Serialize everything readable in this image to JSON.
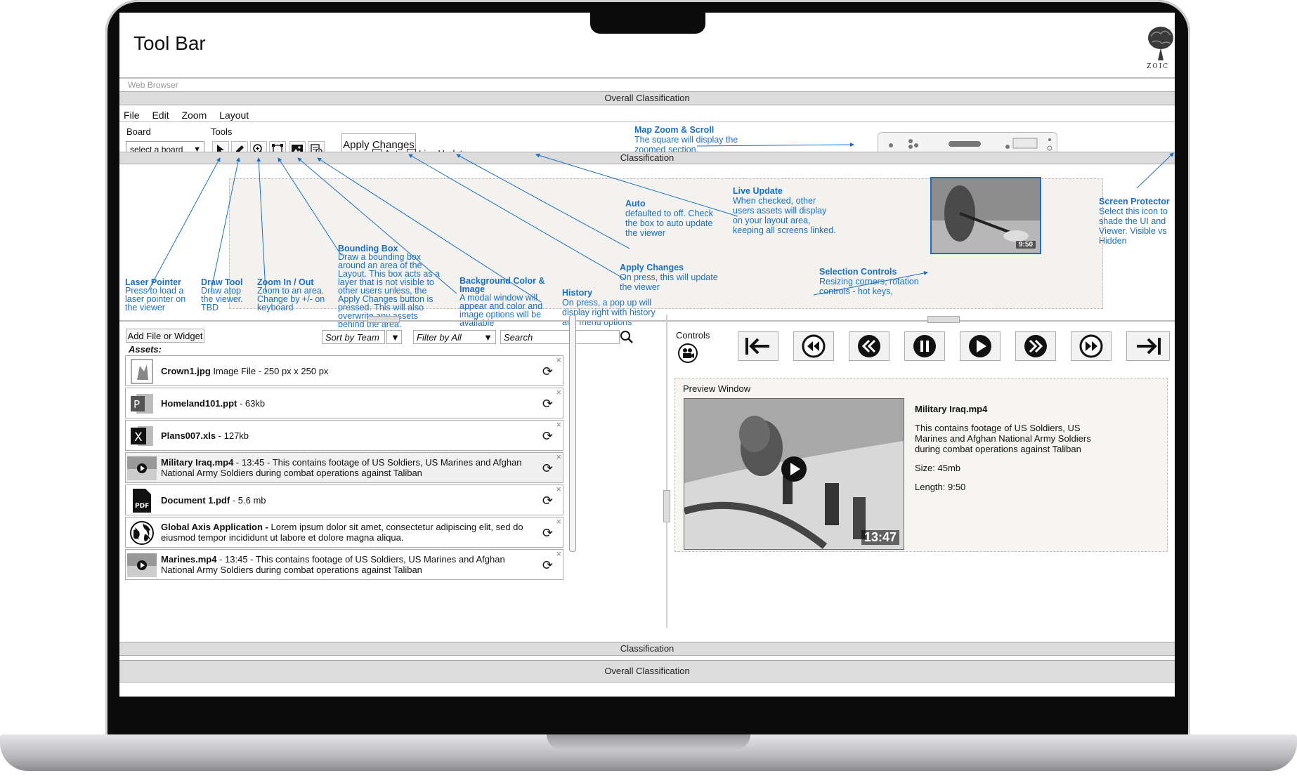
{
  "app": {
    "title": "Tool Bar",
    "logo_text": "ZOIC",
    "web_browser_label": "Web Browser"
  },
  "classification": {
    "overall_top": "Overall Classification",
    "mid_top": "Classification",
    "mid_bottom": "Classification",
    "overall_bottom": "Overall Classification"
  },
  "menu": {
    "items": [
      "File",
      "Edit",
      "Zoom",
      "Layout"
    ]
  },
  "toolbar": {
    "board_label": "Board",
    "board_value": "select a board",
    "tools_label": "Tools",
    "tools": [
      "laser-pointer",
      "draw-tool",
      "zoom",
      "bounding-box",
      "background-image",
      "history"
    ],
    "apply_label": "Apply Changes",
    "auto_label": "Auto",
    "live_update_label": "Live Update"
  },
  "annotations": {
    "map_zoom": {
      "title": "Map Zoom & Scroll",
      "body": "The square will display the zoomed section."
    },
    "live_update": {
      "title": "Live Update",
      "body": "When checked, other users assets will display on your layout area, keeping all screens linked."
    },
    "auto": {
      "title": "Auto",
      "body": "defaulted to off. Check the box to auto update the viewer"
    },
    "screen_protector": {
      "title": "Screen Protector",
      "body": "Select this icon to shade the UI and Viewer. Visible vs Hidden"
    },
    "bounding_box": {
      "title": "Bounding Box",
      "body": "Draw a bounding box around an area of the Layout. This box acts as a layer that is not visible to other users unless, the Apply Changes button is pressed. This will also overwrite any assets behind the area."
    },
    "apply_changes": {
      "title": "Apply Changes",
      "body": "On press, this will update the viewer"
    },
    "selection_controls": {
      "title": "Selection Controls",
      "body": "Resizing corners, rotation controls - hot keys,"
    },
    "laser_pointer": {
      "title": "Laser Pointer",
      "body": "Press to load a laser pointer on the viewer"
    },
    "draw_tool": {
      "title": "Draw Tool",
      "body": "Draw atop the viewer. TBD"
    },
    "zoom": {
      "title": "Zoom In / Out",
      "body": "Zoom to an area. Change by +/- on keyboard"
    },
    "background": {
      "title": "Background Color & Image",
      "body": "A modal window will appear and color and image options will be available"
    },
    "history": {
      "title": "History",
      "body": "On press, a pop up will display right with history and menu options"
    }
  },
  "viewer": {
    "thumb_duration": "9:50"
  },
  "assets_panel": {
    "add_label": "Add File or Widget",
    "sort_label": "Sort by Team",
    "filter_label": "Filter by All",
    "search_placeholder": "Search",
    "assets_label": "Assets:",
    "items": [
      {
        "icon": "image-file-icon",
        "name": "Crown1.jpg",
        "desc": " Image File - 250 px x 250 px"
      },
      {
        "icon": "powerpoint-icon",
        "name": "Homeland101.ppt",
        "desc": " - 63kb"
      },
      {
        "icon": "excel-icon",
        "name": "Plans007.xls",
        "desc": " - 127kb"
      },
      {
        "icon": "video-thumbnail-icon",
        "name": "Military Iraq.mp4",
        "desc": " - 13:45 - This contains footage of US Soldiers, US Marines and Afghan National Army Soldiers during combat operations against Taliban"
      },
      {
        "icon": "pdf-icon",
        "name": "Document 1.pdf",
        "desc": " - 5.6 mb"
      },
      {
        "icon": "globe-icon",
        "name": "Global Axis Application -",
        "desc": " Lorem ipsum dolor sit amet, consectetur adipiscing elit, sed do eiusmod tempor incididunt ut labore et dolore magna aliqua."
      },
      {
        "icon": "video-thumbnail-icon",
        "name": "Marines.mp4",
        "desc": " - 13:45 - This contains footage of US Soldiers, US Marines and Afghan National Army Soldiers during combat operations against Taliban"
      }
    ]
  },
  "controls": {
    "label": "Controls",
    "buttons": [
      "skip-to-start-icon",
      "rewind-icon",
      "fast-back-icon",
      "pause-icon",
      "play-icon",
      "fast-forward-icon",
      "forward-icon",
      "skip-to-end-icon"
    ]
  },
  "preview": {
    "label": "Preview Window",
    "title": "Military Iraq.mp4",
    "description": "This contains footage of US Soldiers, US Marines and Afghan National Army Soldiers during combat operations against Taliban",
    "size": "Size: 45mb",
    "length": "Length: 9:50",
    "duration_badge": "13:47"
  }
}
